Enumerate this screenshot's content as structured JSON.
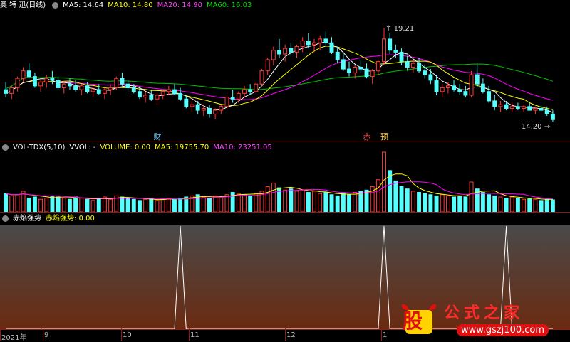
{
  "header": {
    "stock_name": "奥 特 迅",
    "period": "(日线)",
    "ma5_label": "MA5: 14.64",
    "ma10_label": "MA10: 14.80",
    "ma20_label": "MA20: 14.90",
    "ma60_label": "MA60: 16.03"
  },
  "price_panel": {
    "high_annotation": "19.21",
    "low_annotation": "14.20",
    "event_cai": "财",
    "event_chi": "赤",
    "event_yu": "预"
  },
  "volume_header": {
    "indicator": "VOL-TDX(5,10)",
    "vvol": "VVOL: -",
    "volume": "VOLUME: 0.00",
    "ma5": "MA5: 19755.70",
    "ma10": "MA10: 23251.05"
  },
  "indicator_header": {
    "name": "赤焰强势",
    "value": "赤焰强势: 0.00"
  },
  "x_axis": {
    "labels": [
      "2021年",
      "9",
      "10",
      "11",
      "12",
      "1"
    ]
  },
  "watermark": {
    "logo": "股",
    "title": "公式之家",
    "url": "www.gszj100.com"
  },
  "colors": {
    "up": "#ff3a3a",
    "down": "#54ffff",
    "ma5": "#ffffff",
    "ma10": "#ffff00",
    "ma20": "#ff00ff",
    "ma60": "#00c000",
    "separator": "#8a1c1c"
  },
  "chart_data": {
    "type": "candlestick",
    "price_range": [
      13.4,
      20.0
    ],
    "candles": [
      [
        15.9,
        16.3,
        15.5,
        15.7
      ],
      [
        15.7,
        16.1,
        15.4,
        16.0
      ],
      [
        16.0,
        16.6,
        15.8,
        16.5
      ],
      [
        16.5,
        17.1,
        16.3,
        16.9
      ],
      [
        16.9,
        17.3,
        16.5,
        16.6
      ],
      [
        16.6,
        16.8,
        16.0,
        16.1
      ],
      [
        16.1,
        16.4,
        15.8,
        16.3
      ],
      [
        16.3,
        16.7,
        16.0,
        16.5
      ],
      [
        16.5,
        16.9,
        16.2,
        16.4
      ],
      [
        16.4,
        16.6,
        15.9,
        16.0
      ],
      [
        16.0,
        16.3,
        15.7,
        16.2
      ],
      [
        16.2,
        16.5,
        15.9,
        16.1
      ],
      [
        16.1,
        16.4,
        15.8,
        15.9
      ],
      [
        15.9,
        16.2,
        15.6,
        16.1
      ],
      [
        16.1,
        16.3,
        15.7,
        15.8
      ],
      [
        15.8,
        16.1,
        15.5,
        15.9
      ],
      [
        15.9,
        16.2,
        15.6,
        15.7
      ],
      [
        15.7,
        16.0,
        15.4,
        15.9
      ],
      [
        15.9,
        16.2,
        15.6,
        16.0
      ],
      [
        16.0,
        16.6,
        15.9,
        16.5
      ],
      [
        16.5,
        16.8,
        16.1,
        16.2
      ],
      [
        16.2,
        16.4,
        15.8,
        16.0
      ],
      [
        16.0,
        16.2,
        15.7,
        15.8
      ],
      [
        15.8,
        16.0,
        15.4,
        15.5
      ],
      [
        15.5,
        15.8,
        15.2,
        15.6
      ],
      [
        15.6,
        15.9,
        15.3,
        15.4
      ],
      [
        15.4,
        15.7,
        15.1,
        15.6
      ],
      [
        15.6,
        15.9,
        15.4,
        15.8
      ],
      [
        15.8,
        16.1,
        15.6,
        15.9
      ],
      [
        15.9,
        16.2,
        15.6,
        15.7
      ],
      [
        15.7,
        16.0,
        15.3,
        15.4
      ],
      [
        15.4,
        15.6,
        14.9,
        15.0
      ],
      [
        15.0,
        15.3,
        14.7,
        15.1
      ],
      [
        15.1,
        15.3,
        14.6,
        14.8
      ],
      [
        14.8,
        15.1,
        14.5,
        14.9
      ],
      [
        14.9,
        15.1,
        14.4,
        14.6
      ],
      [
        14.6,
        14.9,
        14.3,
        14.8
      ],
      [
        14.8,
        15.1,
        14.6,
        15.0
      ],
      [
        15.0,
        15.6,
        14.9,
        15.5
      ],
      [
        15.5,
        15.9,
        15.2,
        15.4
      ],
      [
        15.4,
        15.8,
        15.2,
        15.7
      ],
      [
        15.7,
        16.1,
        15.5,
        15.9
      ],
      [
        15.9,
        16.2,
        15.6,
        15.8
      ],
      [
        15.8,
        16.3,
        15.7,
        16.2
      ],
      [
        16.2,
        17.0,
        16.1,
        16.9
      ],
      [
        16.9,
        17.6,
        16.7,
        17.5
      ],
      [
        17.5,
        18.2,
        17.2,
        18.0
      ],
      [
        18.0,
        18.6,
        17.6,
        17.8
      ],
      [
        17.8,
        18.3,
        17.4,
        18.1
      ],
      [
        18.1,
        18.4,
        17.7,
        17.9
      ],
      [
        17.9,
        18.3,
        17.6,
        18.2
      ],
      [
        18.2,
        18.7,
        17.9,
        18.5
      ],
      [
        18.5,
        18.9,
        18.1,
        18.3
      ],
      [
        18.3,
        18.6,
        17.9,
        18.4
      ],
      [
        18.4,
        18.8,
        18.0,
        18.6
      ],
      [
        18.6,
        19.0,
        18.2,
        18.4
      ],
      [
        18.4,
        18.7,
        17.8,
        17.9
      ],
      [
        17.9,
        18.2,
        17.3,
        17.5
      ],
      [
        17.5,
        17.8,
        16.9,
        17.0
      ],
      [
        17.0,
        17.4,
        16.6,
        16.8
      ],
      [
        16.8,
        17.2,
        16.5,
        17.1
      ],
      [
        17.1,
        17.5,
        16.8,
        17.0
      ],
      [
        17.0,
        17.3,
        16.5,
        16.6
      ],
      [
        16.6,
        17.0,
        16.2,
        16.9
      ],
      [
        16.9,
        17.5,
        16.7,
        17.4
      ],
      [
        17.4,
        19.21,
        17.2,
        18.6
      ],
      [
        18.6,
        18.9,
        17.8,
        18.0
      ],
      [
        18.0,
        18.3,
        17.6,
        17.9
      ],
      [
        17.9,
        18.1,
        17.2,
        17.4
      ],
      [
        17.4,
        17.7,
        16.9,
        17.1
      ],
      [
        17.1,
        17.5,
        16.8,
        17.3
      ],
      [
        17.3,
        17.6,
        16.8,
        16.9
      ],
      [
        16.9,
        17.2,
        16.5,
        16.7
      ],
      [
        16.7,
        17.0,
        16.2,
        16.4
      ],
      [
        16.4,
        16.7,
        15.6,
        15.8
      ],
      [
        15.8,
        16.2,
        15.5,
        16.0
      ],
      [
        16.0,
        16.3,
        15.7,
        16.1
      ],
      [
        16.1,
        16.4,
        15.8,
        15.9
      ],
      [
        15.9,
        16.2,
        15.6,
        15.8
      ],
      [
        15.8,
        16.1,
        15.5,
        15.6
      ],
      [
        15.6,
        16.9,
        15.5,
        16.7
      ],
      [
        16.7,
        17.2,
        16.0,
        16.2
      ],
      [
        16.2,
        16.5,
        15.7,
        15.8
      ],
      [
        15.8,
        16.1,
        15.2,
        15.3
      ],
      [
        15.3,
        15.6,
        14.8,
        15.0
      ],
      [
        15.0,
        15.3,
        14.7,
        15.1
      ],
      [
        15.1,
        15.3,
        14.8,
        14.9
      ],
      [
        14.9,
        15.2,
        14.7,
        15.0
      ],
      [
        15.0,
        15.2,
        14.8,
        14.9
      ],
      [
        14.9,
        15.1,
        14.7,
        15.0
      ],
      [
        15.0,
        15.2,
        14.8,
        14.8
      ],
      [
        14.8,
        15.0,
        14.6,
        14.9
      ],
      [
        14.9,
        15.1,
        14.7,
        14.8
      ],
      [
        14.8,
        15.0,
        14.5,
        14.6
      ],
      [
        14.6,
        14.8,
        14.2,
        14.3
      ]
    ],
    "volume": [
      16000,
      14000,
      15000,
      18000,
      12000,
      13000,
      11000,
      12000,
      14000,
      13000,
      12000,
      11000,
      13000,
      12000,
      11000,
      10000,
      12000,
      13000,
      11000,
      14000,
      13000,
      12000,
      11000,
      10000,
      11000,
      12000,
      10000,
      11000,
      12000,
      11000,
      12000,
      13000,
      14000,
      15000,
      13000,
      12000,
      14000,
      13000,
      15000,
      17000,
      16000,
      15000,
      14000,
      16000,
      18000,
      22000,
      25000,
      21000,
      19000,
      20000,
      18000,
      19000,
      17000,
      18000,
      16000,
      17000,
      15000,
      14000,
      16000,
      15000,
      17000,
      18000,
      19000,
      22000,
      28000,
      52000,
      36000,
      27000,
      22000,
      20000,
      18000,
      17000,
      16000,
      15000,
      14000,
      15000,
      14000,
      13000,
      14000,
      13000,
      26000,
      20000,
      17000,
      15000,
      14000,
      13000,
      12000,
      13000,
      12000,
      11000,
      12000,
      11000,
      10000,
      11000,
      10500
    ],
    "indicator_spikes": [
      30,
      65,
      86
    ],
    "indicator_range": [
      0,
      1
    ]
  }
}
